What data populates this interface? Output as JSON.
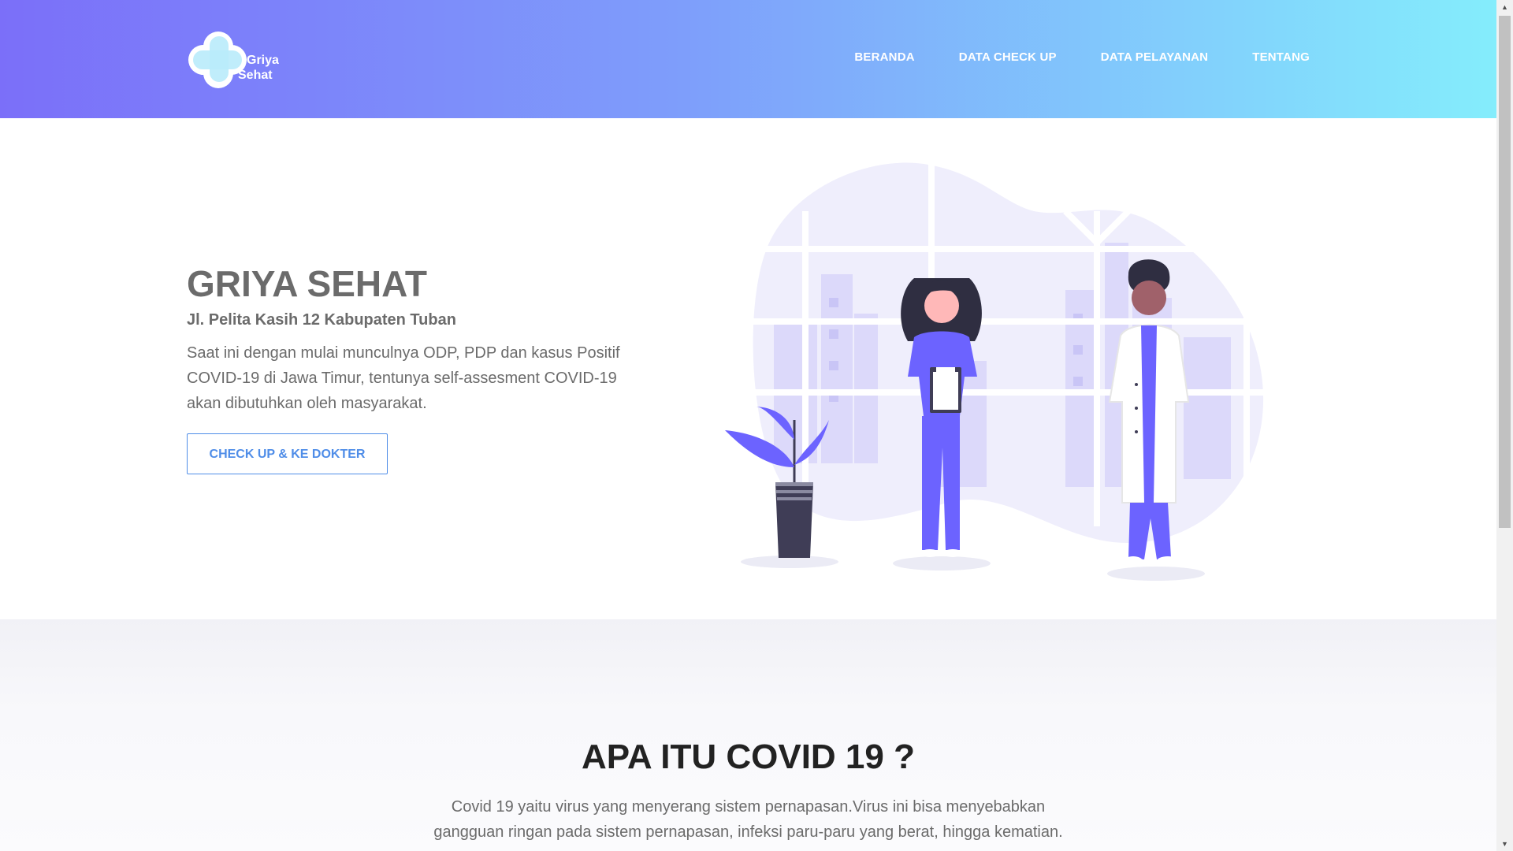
{
  "brand": {
    "line1": "Griya",
    "line2": "Sehat"
  },
  "nav": {
    "items": [
      {
        "label": "BERANDA"
      },
      {
        "label": "DATA CHECK UP"
      },
      {
        "label": "DATA PELAYANAN"
      },
      {
        "label": "TENTANG"
      }
    ]
  },
  "hero": {
    "title": "GRIYA SEHAT",
    "address": "Jl. Pelita Kasih 12 Kabupaten Tuban",
    "description": "Saat ini dengan mulai munculnya ODP, PDP dan kasus Positif COVID-19 di Jawa Timur, tentunya self-assesment COVID-19 akan dibutuhkan oleh masyarakat.",
    "cta_label": "CHECK UP & KE DOKTER"
  },
  "about": {
    "title": "APA ITU COVID 19 ?",
    "line1": "Covid 19 yaitu virus yang menyerang sistem pernapasan.Virus ini bisa menyebabkan",
    "line2": "gangguan ringan pada sistem pernapasan, infeksi paru-paru yang berat, hingga kematian."
  },
  "colors": {
    "header_start": "#7b6ff9",
    "header_end": "#84edfc",
    "accent": "#4f8de8",
    "illustration_purple": "#6c63ff"
  },
  "icons": {
    "logo": "medical-cross-icon"
  }
}
